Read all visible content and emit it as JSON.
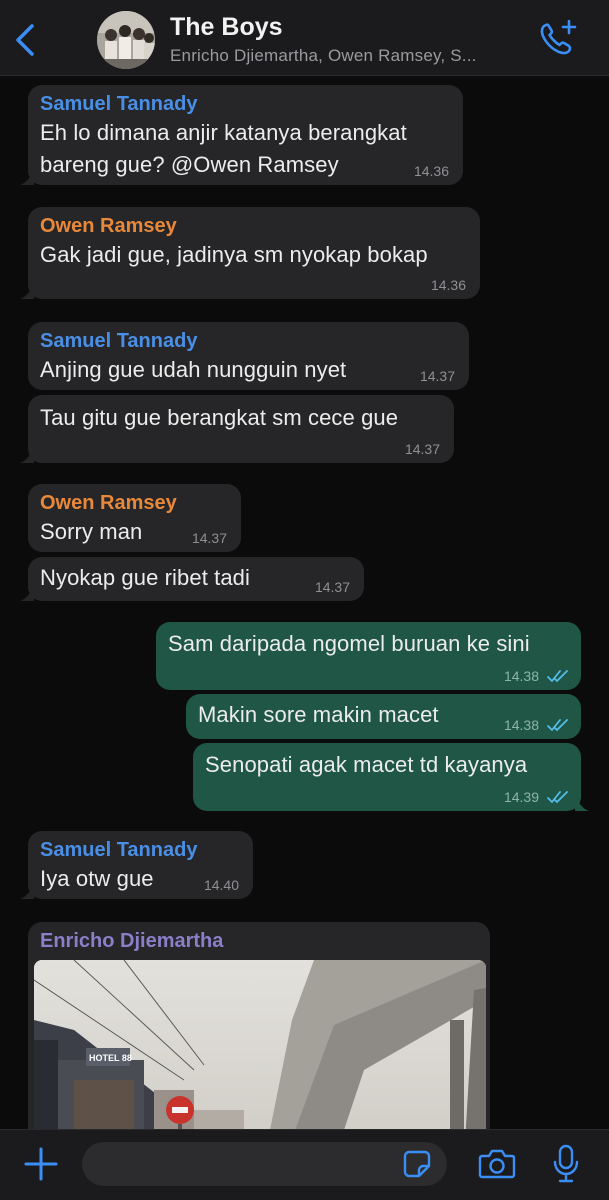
{
  "header": {
    "back_icon": "chevron-left-icon",
    "avatar": "group-photo",
    "title": "The Boys",
    "subtitle": "Enricho Djiemartha, Owen Ramsey, S...",
    "call_icon": "phone-add-icon"
  },
  "colors": {
    "accent": "#3a8ef6",
    "outgoing_bubble": "#1f5646",
    "incoming_bubble": "#262628",
    "sender_samuel": "#4a8fe6",
    "sender_owen": "#e8883a",
    "sender_enricho": "#8a7fc8",
    "read_ticks": "#53bdeb"
  },
  "messages": [
    {
      "sender": "Samuel Tannady",
      "text": "Eh lo dimana anjir katanya berangkat bareng gue? @Owen Ramsey",
      "time": "14.36"
    },
    {
      "sender": "Owen Ramsey",
      "text": "Gak jadi gue, jadinya sm nyokap bokap",
      "time": "14.36"
    },
    {
      "sender": "Samuel Tannady",
      "text": "Anjing gue udah nungguin nyet",
      "time": "14.37"
    },
    {
      "sender": "",
      "text": "Tau gitu gue berangkat sm cece gue",
      "time": "14.37"
    },
    {
      "sender": "Owen Ramsey",
      "text": "Sorry man",
      "time": "14.37"
    },
    {
      "sender": "",
      "text": "Nyokap gue ribet tadi",
      "time": "14.37"
    },
    {
      "sender": "",
      "text": "Sam daripada ngomel buruan ke sini",
      "time": "14.38"
    },
    {
      "sender": "",
      "text": "Makin sore makin macet",
      "time": "14.38"
    },
    {
      "sender": "",
      "text": "Senopati agak macet td kayanya",
      "time": "14.39"
    },
    {
      "sender": "Samuel Tannady",
      "text": "Iya otw gue",
      "time": "14.40"
    },
    {
      "sender": "Enricho Djiemartha",
      "text": "",
      "time": ""
    }
  ],
  "photo": {
    "sign_text": "HOTEL 88"
  },
  "input": {
    "plus_icon": "plus-icon",
    "placeholder": "",
    "sticker_icon": "sticker-icon",
    "camera_icon": "camera-icon",
    "mic_icon": "microphone-icon"
  }
}
